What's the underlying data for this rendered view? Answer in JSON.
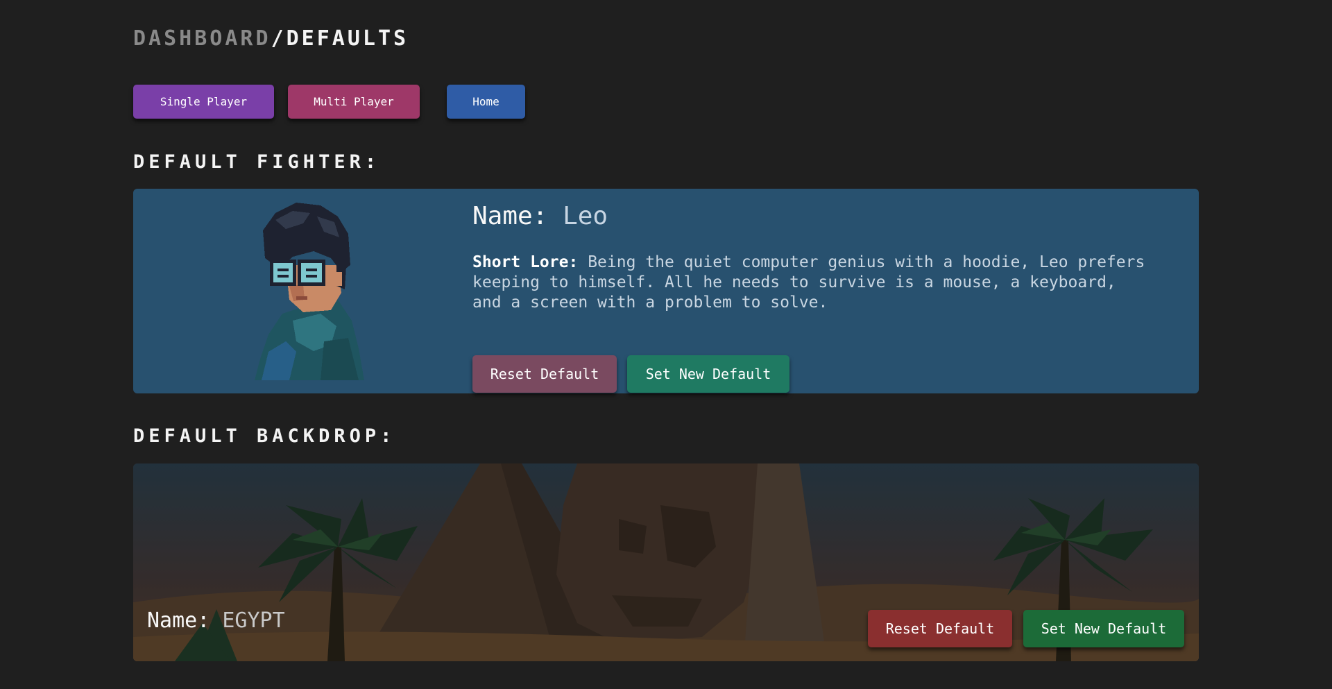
{
  "breadcrumb": {
    "parent": "DASHBOARD",
    "separator": "/",
    "current": "DEFAULTS"
  },
  "nav": {
    "single_player": "Single Player",
    "multi_player": "Multi Player",
    "home": "Home"
  },
  "fighter_section": {
    "title": "DEFAULT FIGHTER:",
    "name_label": "Name:",
    "name_value": "Leo",
    "lore_label": "Short Lore:",
    "lore_value": "Being the quiet computer genius with a hoodie, Leo prefers keeping to himself. All he needs to survive is a mouse, a keyboard, and a screen with a problem to solve.",
    "reset_label": "Reset Default",
    "set_label": "Set New Default"
  },
  "backdrop_section": {
    "title": "DEFAULT BACKDROP:",
    "name_label": "Name:",
    "name_value": "EGYPT",
    "reset_label": "Reset Default",
    "set_label": "Set New Default"
  },
  "colors": {
    "page_background": "#1f1f1f",
    "single_player_button": "#7a3fa8",
    "multi_player_button": "#9e3868",
    "home_button": "#2f5ca6",
    "fighter_card": "#28516f",
    "fighter_reset_button": "#7a4a60",
    "fighter_set_button": "#1f7a62",
    "backdrop_reset_button": "#8a2f2f",
    "backdrop_set_button": "#1c6b38"
  }
}
